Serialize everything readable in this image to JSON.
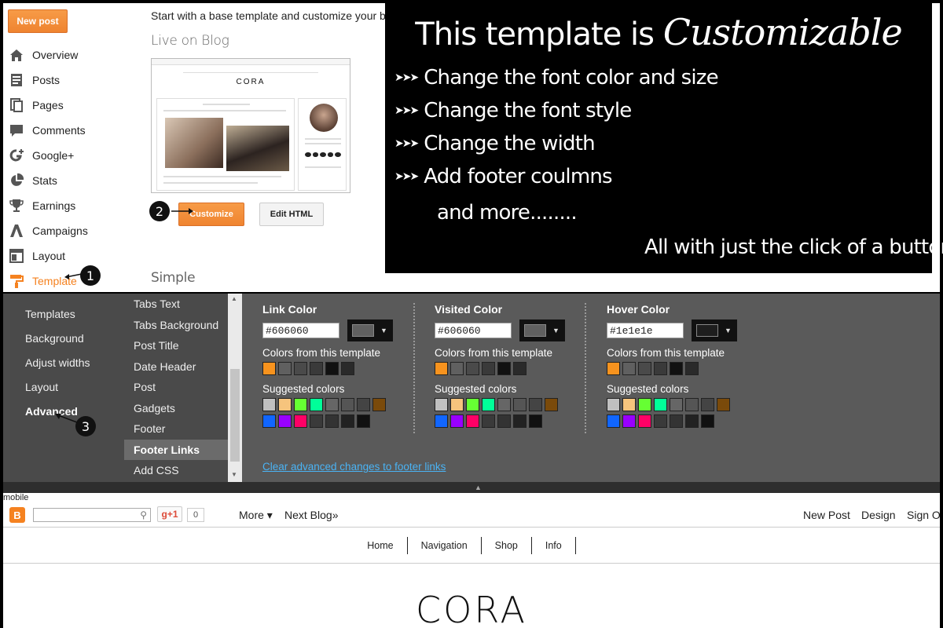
{
  "top": {
    "new_post": "New post",
    "heading": "Start with a base template and customize your b",
    "live_label": "Live on Blog",
    "simple_label": "Simple",
    "nav": [
      {
        "label": "Overview",
        "icon": "home-icon"
      },
      {
        "label": "Posts",
        "icon": "posts-icon"
      },
      {
        "label": "Pages",
        "icon": "pages-icon"
      },
      {
        "label": "Comments",
        "icon": "comment-icon"
      },
      {
        "label": "Google+",
        "icon": "google-plus-icon"
      },
      {
        "label": "Stats",
        "icon": "pie-chart-icon"
      },
      {
        "label": "Earnings",
        "icon": "trophy-icon"
      },
      {
        "label": "Campaigns",
        "icon": "adwords-icon"
      },
      {
        "label": "Layout",
        "icon": "layout-icon"
      },
      {
        "label": "Template",
        "icon": "paint-roller-icon"
      }
    ],
    "customize": "Customize",
    "edit_html": "Edit HTML",
    "preview_logo": "CORA"
  },
  "steps": {
    "one": "1",
    "two": "2",
    "three": "3"
  },
  "banner": {
    "title_plain": "This template is",
    "title_script": "Customizable",
    "arrow": "➤➤➤",
    "items": [
      "Change the font color and size",
      "Change the font style",
      "Change the width",
      "Add footer coulmns"
    ],
    "more": "and more........",
    "footer": "All with just the click of a button!"
  },
  "designer": {
    "categories": [
      "Templates",
      "Background",
      "Adjust widths",
      "Layout",
      "Advanced"
    ],
    "selected_category": "Advanced",
    "subitems": [
      "Tabs Text",
      "Tabs Background",
      "Post Title",
      "Date Header",
      "Post",
      "Gadgets",
      "Footer",
      "Footer Links",
      "Add CSS"
    ],
    "selected_subitem": "Footer Links",
    "columns": [
      {
        "title": "Link Color",
        "hex": "#606060",
        "swatch": "#606060"
      },
      {
        "title": "Visited Color",
        "hex": "#606060",
        "swatch": "#606060"
      },
      {
        "title": "Hover Color",
        "hex": "#1e1e1e",
        "swatch": "#1e1e1e"
      }
    ],
    "colors_from_template_label": "Colors from this template",
    "suggested_label": "Suggested colors",
    "template_colors": [
      "#f7931e",
      "#606060",
      "#4a4a4a",
      "#3a3a3a",
      "#111111",
      "#2a2a2a"
    ],
    "suggested_row1": [
      "#c0c0c0",
      "#f6c47d",
      "#66ff33",
      "#00ff99",
      "#666666",
      "#555555",
      "#444444",
      "#7a4a0a"
    ],
    "suggested_row2": [
      "#1166ff",
      "#9900ff",
      "#ff0066",
      "#3a3a3a",
      "#333333",
      "#222222",
      "#111111",
      "#262626"
    ],
    "clear_link": "Clear advanced changes to footer links"
  },
  "blog": {
    "mobile": "mobile",
    "logo_letter": "B",
    "gplus": "g+1",
    "count": "0",
    "more": "More ▾",
    "next_blog": "Next Blog»",
    "new_post": "New Post",
    "design": "Design",
    "sign_out": "Sign O",
    "nav": [
      "Home",
      "Navigation",
      "Shop",
      "Info"
    ],
    "title": "CORA"
  }
}
